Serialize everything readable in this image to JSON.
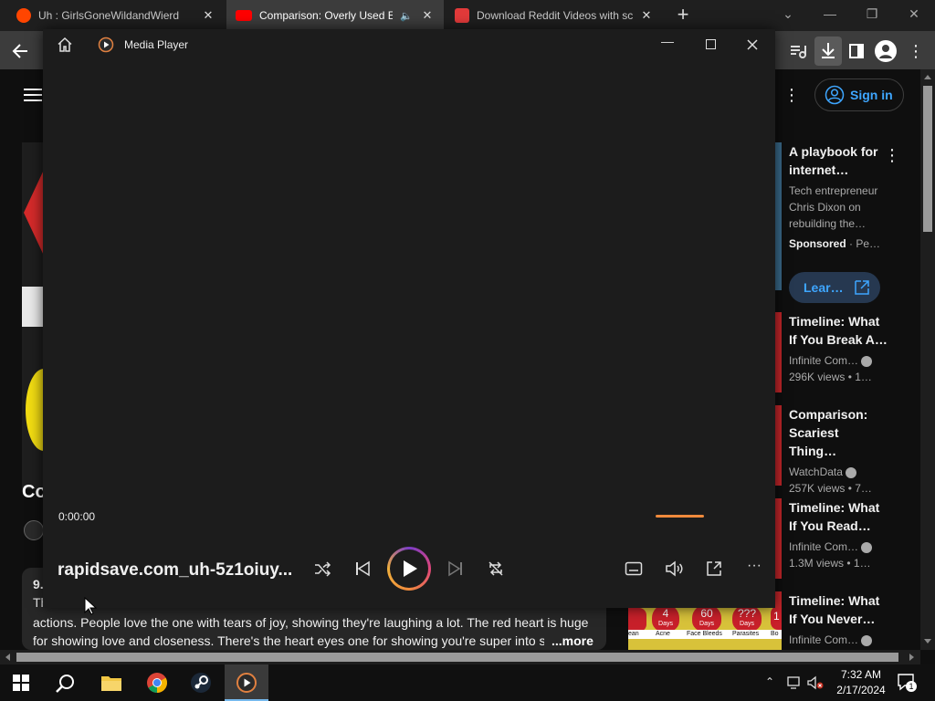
{
  "browser": {
    "tabs": [
      {
        "title": "Uh : GirlsGoneWildandWierd",
        "favicon": "reddit-icon",
        "active": false
      },
      {
        "title": "Comparison: Overly Used Er",
        "favicon": "youtube-icon",
        "active": true,
        "audio": "speaker-icon"
      },
      {
        "title": "Download Reddit Videos with sc",
        "favicon": "rapidsave-icon",
        "active": false
      }
    ],
    "new_tab_label": "+",
    "window_controls": [
      "chevron-down-icon",
      "minimize-icon",
      "restore-icon",
      "close-icon"
    ]
  },
  "youtube": {
    "sign_in_label": "Sign in",
    "video_title_fragment": "Co",
    "description": {
      "views_prefix": "9.",
      "line1_start": "The",
      "line1_end": "actions. People love the one with tears of joy, showing they're laughing a lot. The red heart is huge",
      "line2": "for showing love and closeness. There's the heart eyes one for showing you're super into so",
      "more_label": "...more"
    },
    "ad": {
      "title": "A playbook for internet…",
      "description": "Tech entrepreneur Chris Dixon on rebuilding the…",
      "sponsored": "Sponsored",
      "advertiser": "Pe…",
      "cta": "Lear…"
    },
    "recommendations": [
      {
        "title": "Timeline: What If You Break A…",
        "channel": "Infinite Com…",
        "views": "296K views",
        "age": "1…"
      },
      {
        "title": "Comparison: Scariest Thing…",
        "channel": "WatchData",
        "views": "257K views",
        "age": "7…"
      },
      {
        "title": "Timeline: What If You Read…",
        "channel": "Infinite Com…",
        "views": "1.3M views",
        "age": "1…"
      },
      {
        "title": "Timeline: What If You Never…",
        "channel": "Infinite Com…",
        "views": "",
        "age": ""
      }
    ],
    "thumb_labels": [
      "4",
      "Days",
      "60",
      "Days",
      "???",
      "Days",
      "1"
    ],
    "thumb_captions": [
      "ean",
      "Acne",
      "Face Bleeds",
      "Parasites",
      "Bo"
    ]
  },
  "player": {
    "app_title": "Media Player",
    "current_time": "0:00:00",
    "file_name": "rapidsave.com_uh-5z1oiuy...",
    "progress_fraction": 0,
    "accent": "#f08a3c"
  },
  "taskbar": {
    "time": "7:32 AM",
    "date": "2/17/2024",
    "notification_count": "1"
  }
}
